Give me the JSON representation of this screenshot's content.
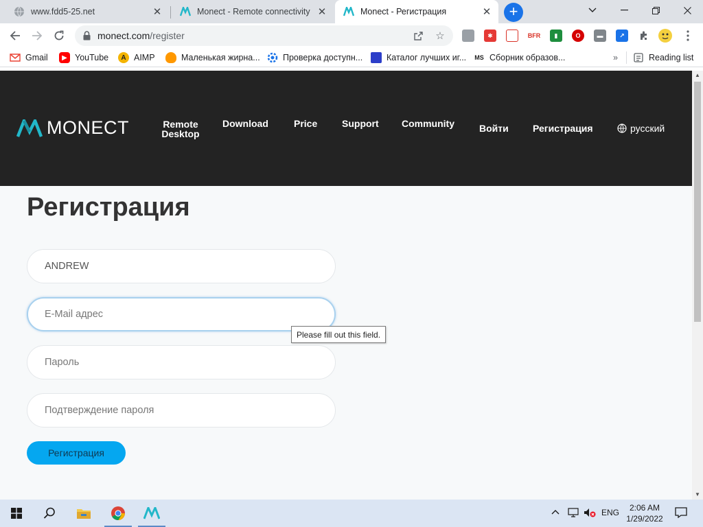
{
  "browser": {
    "tabs": [
      {
        "title": "www.fdd5-25.net"
      },
      {
        "title": "Monect - Remote connectivity | R"
      },
      {
        "title": "Monect - Регистрация"
      }
    ],
    "omnibox": {
      "host": "monect.com",
      "path": "/register"
    },
    "bookmarks": [
      {
        "label": "Gmail"
      },
      {
        "label": "YouTube"
      },
      {
        "label": "AIMP"
      },
      {
        "label": "Маленькая жирна..."
      },
      {
        "label": "Проверка доступн..."
      },
      {
        "label": "Каталог лучших иг..."
      },
      {
        "label": "Сборник образов..."
      }
    ],
    "more_bookmarks": "»",
    "reading_list": "Reading list",
    "extensions": [
      {
        "icon": "extension-1-icon",
        "color": "#9aa0a6"
      },
      {
        "icon": "extension-2-icon",
        "color": "#e53935"
      },
      {
        "icon": "extension-3-icon",
        "color": "#d93025"
      },
      {
        "icon": "extension-4-icon",
        "color": "#d93025"
      },
      {
        "icon": "extension-5-icon",
        "color": "#1e8e3e"
      },
      {
        "icon": "extension-6-icon",
        "color": "#d50000"
      },
      {
        "icon": "extension-7-icon",
        "color": "#80868b"
      },
      {
        "icon": "extension-8-icon",
        "color": "#1a73e8"
      }
    ]
  },
  "site": {
    "logo_text": "MONECT",
    "nav": {
      "remote_desktop_line1": "Remote",
      "remote_desktop_line2": "Desktop",
      "download": "Download",
      "price": "Price",
      "support": "Support",
      "community": "Community",
      "login": "Войти",
      "register": "Регистрация",
      "language": "русский"
    },
    "accent_color": "#05a7f0",
    "header_bg": "#232323"
  },
  "form": {
    "title": "Регистрация",
    "name_value": "ANDREW",
    "email_placeholder": "E-Mail адрес",
    "password_placeholder": "Пароль",
    "confirm_placeholder": "Подтверждение пароля",
    "submit_label": "Регистрация",
    "validation_tooltip": "Please fill out this field."
  },
  "taskbar": {
    "language": "ENG",
    "time": "2:06 AM",
    "date": "1/29/2022"
  }
}
